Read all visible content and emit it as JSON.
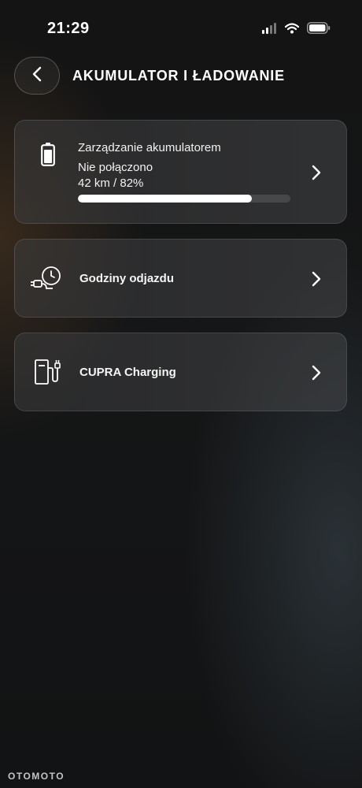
{
  "status_bar": {
    "time": "21:29",
    "signal_icon": "cellular-signal-icon",
    "wifi_icon": "wifi-icon",
    "battery_icon": "phone-battery-icon"
  },
  "header": {
    "back_icon": "chevron-left-icon",
    "title": "AKUMULATOR I ŁADOWANIE"
  },
  "battery_card": {
    "icon": "battery-icon",
    "title": "Zarządzanie akumulatorem",
    "status": "Nie połączono",
    "range": "42 km / 82%",
    "charge_level": 0.82,
    "chevron_icon": "chevron-right-icon"
  },
  "menu": [
    {
      "icon": "departure-timer-plug-icon",
      "label": "Godziny odjazdu",
      "chevron_icon": "chevron-right-icon"
    },
    {
      "icon": "charging-station-icon",
      "label": "CUPRA Charging",
      "chevron_icon": "chevron-right-icon"
    }
  ],
  "watermark": "OTOMOTO",
  "colors": {
    "background": "#141414",
    "card": "#3c3c3e",
    "text": "#ffffff",
    "progress": "#ffffff"
  }
}
